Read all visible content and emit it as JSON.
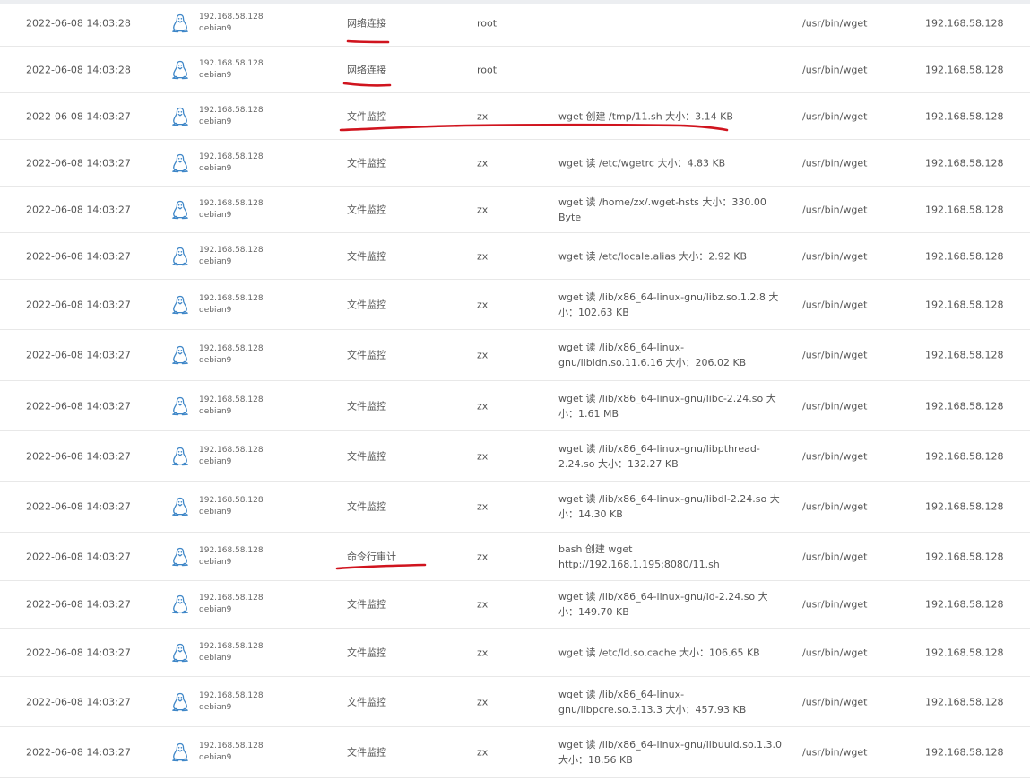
{
  "icons": {
    "os": "linux-tux-icon"
  },
  "colors": {
    "annotation": "#d0141e",
    "icon": "#3f87c8",
    "text": "#555555"
  },
  "rows": [
    {
      "time": "2022-06-08 14:03:28",
      "host_ip": "192.168.58.128",
      "host_name": "debian9",
      "type": "网络连接",
      "user": "root",
      "detail": "",
      "process": "/usr/bin/wget",
      "ip": "192.168.58.128"
    },
    {
      "time": "2022-06-08 14:03:28",
      "host_ip": "192.168.58.128",
      "host_name": "debian9",
      "type": "网络连接",
      "user": "root",
      "detail": "",
      "process": "/usr/bin/wget",
      "ip": "192.168.58.128"
    },
    {
      "time": "2022-06-08 14:03:27",
      "host_ip": "192.168.58.128",
      "host_name": "debian9",
      "type": "文件监控",
      "user": "zx",
      "detail": "wget 创建 /tmp/11.sh 大小：3.14 KB",
      "process": "/usr/bin/wget",
      "ip": "192.168.58.128"
    },
    {
      "time": "2022-06-08 14:03:27",
      "host_ip": "192.168.58.128",
      "host_name": "debian9",
      "type": "文件监控",
      "user": "zx",
      "detail": "wget 读 /etc/wgetrc 大小：4.83 KB",
      "process": "/usr/bin/wget",
      "ip": "192.168.58.128"
    },
    {
      "time": "2022-06-08 14:03:27",
      "host_ip": "192.168.58.128",
      "host_name": "debian9",
      "type": "文件监控",
      "user": "zx",
      "detail": "wget 读 /home/zx/.wget-hsts 大小：330.00 Byte",
      "process": "/usr/bin/wget",
      "ip": "192.168.58.128"
    },
    {
      "time": "2022-06-08 14:03:27",
      "host_ip": "192.168.58.128",
      "host_name": "debian9",
      "type": "文件监控",
      "user": "zx",
      "detail": "wget 读 /etc/locale.alias 大小：2.92 KB",
      "process": "/usr/bin/wget",
      "ip": "192.168.58.128"
    },
    {
      "time": "2022-06-08 14:03:27",
      "host_ip": "192.168.58.128",
      "host_name": "debian9",
      "type": "文件监控",
      "user": "zx",
      "detail": "wget 读 /lib/x86_64-linux-gnu/libz.so.1.2.8 大小：102.63 KB",
      "process": "/usr/bin/wget",
      "ip": "192.168.58.128"
    },
    {
      "time": "2022-06-08 14:03:27",
      "host_ip": "192.168.58.128",
      "host_name": "debian9",
      "type": "文件监控",
      "user": "zx",
      "detail": "wget 读 /lib/x86_64-linux-gnu/libidn.so.11.6.16 大小：206.02 KB",
      "process": "/usr/bin/wget",
      "ip": "192.168.58.128"
    },
    {
      "time": "2022-06-08 14:03:27",
      "host_ip": "192.168.58.128",
      "host_name": "debian9",
      "type": "文件监控",
      "user": "zx",
      "detail": "wget 读 /lib/x86_64-linux-gnu/libc-2.24.so 大小：1.61 MB",
      "process": "/usr/bin/wget",
      "ip": "192.168.58.128"
    },
    {
      "time": "2022-06-08 14:03:27",
      "host_ip": "192.168.58.128",
      "host_name": "debian9",
      "type": "文件监控",
      "user": "zx",
      "detail": "wget 读 /lib/x86_64-linux-gnu/libpthread-2.24.so 大小：132.27 KB",
      "process": "/usr/bin/wget",
      "ip": "192.168.58.128"
    },
    {
      "time": "2022-06-08 14:03:27",
      "host_ip": "192.168.58.128",
      "host_name": "debian9",
      "type": "文件监控",
      "user": "zx",
      "detail": "wget 读 /lib/x86_64-linux-gnu/libdl-2.24.so 大小：14.30 KB",
      "process": "/usr/bin/wget",
      "ip": "192.168.58.128"
    },
    {
      "time": "2022-06-08 14:03:27",
      "host_ip": "192.168.58.128",
      "host_name": "debian9",
      "type": "命令行审计",
      "user": "zx",
      "detail": "bash 创建 wget http://192.168.1.195:8080/11.sh",
      "process": "/usr/bin/wget",
      "ip": "192.168.58.128"
    },
    {
      "time": "2022-06-08 14:03:27",
      "host_ip": "192.168.58.128",
      "host_name": "debian9",
      "type": "文件监控",
      "user": "zx",
      "detail": "wget 读 /lib/x86_64-linux-gnu/ld-2.24.so 大小：149.70 KB",
      "process": "/usr/bin/wget",
      "ip": "192.168.58.128"
    },
    {
      "time": "2022-06-08 14:03:27",
      "host_ip": "192.168.58.128",
      "host_name": "debian9",
      "type": "文件监控",
      "user": "zx",
      "detail": "wget 读 /etc/ld.so.cache 大小：106.65 KB",
      "process": "/usr/bin/wget",
      "ip": "192.168.58.128"
    },
    {
      "time": "2022-06-08 14:03:27",
      "host_ip": "192.168.58.128",
      "host_name": "debian9",
      "type": "文件监控",
      "user": "zx",
      "detail": "wget 读 /lib/x86_64-linux-gnu/libpcre.so.3.13.3 大小：457.93 KB",
      "process": "/usr/bin/wget",
      "ip": "192.168.58.128"
    },
    {
      "time": "2022-06-08 14:03:27",
      "host_ip": "192.168.58.128",
      "host_name": "debian9",
      "type": "文件监控",
      "user": "zx",
      "detail": "wget 读 /lib/x86_64-linux-gnu/libuuid.so.1.3.0 大小：18.56 KB",
      "process": "/usr/bin/wget",
      "ip": "192.168.58.128"
    }
  ]
}
